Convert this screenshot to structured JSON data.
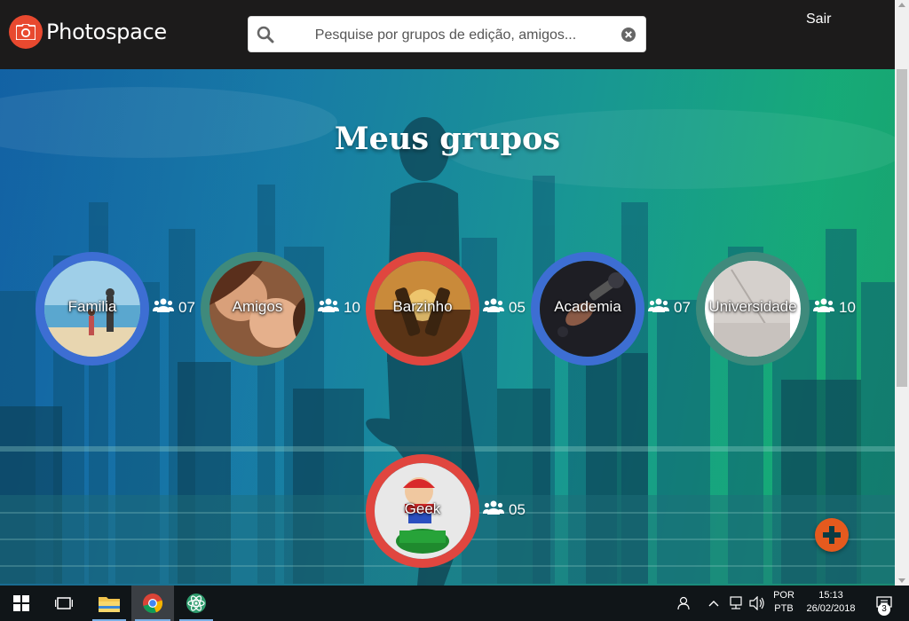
{
  "app": {
    "name": "Photospace"
  },
  "header": {
    "search_placeholder": "Pesquise por grupos de edição, amigos...",
    "search_value": "",
    "logout_label": "Sair"
  },
  "main": {
    "title": "Meus grupos",
    "add_button": "add-group",
    "groups": [
      {
        "name": "Familia",
        "members": "07",
        "ring_color": "#3d6ed3"
      },
      {
        "name": "Amigos",
        "members": "10",
        "ring_color": "#3f8a7c"
      },
      {
        "name": "Barzinho",
        "members": "05",
        "ring_color": "#e0463f"
      },
      {
        "name": "Academia",
        "members": "07",
        "ring_color": "#3d6ed3"
      },
      {
        "name": "Universidade",
        "members": "10",
        "ring_color": "#3f8a7c"
      },
      {
        "name": "Geek",
        "members": "05",
        "ring_color": "#e0463f"
      }
    ]
  },
  "taskbar": {
    "language": "POR",
    "layout": "PTB",
    "time": "15:13",
    "date": "26/02/2018",
    "notifications": "3"
  },
  "colors": {
    "header_bg": "#1c1b1b",
    "accent": "#e8492f",
    "fab": "#e55a1e"
  }
}
